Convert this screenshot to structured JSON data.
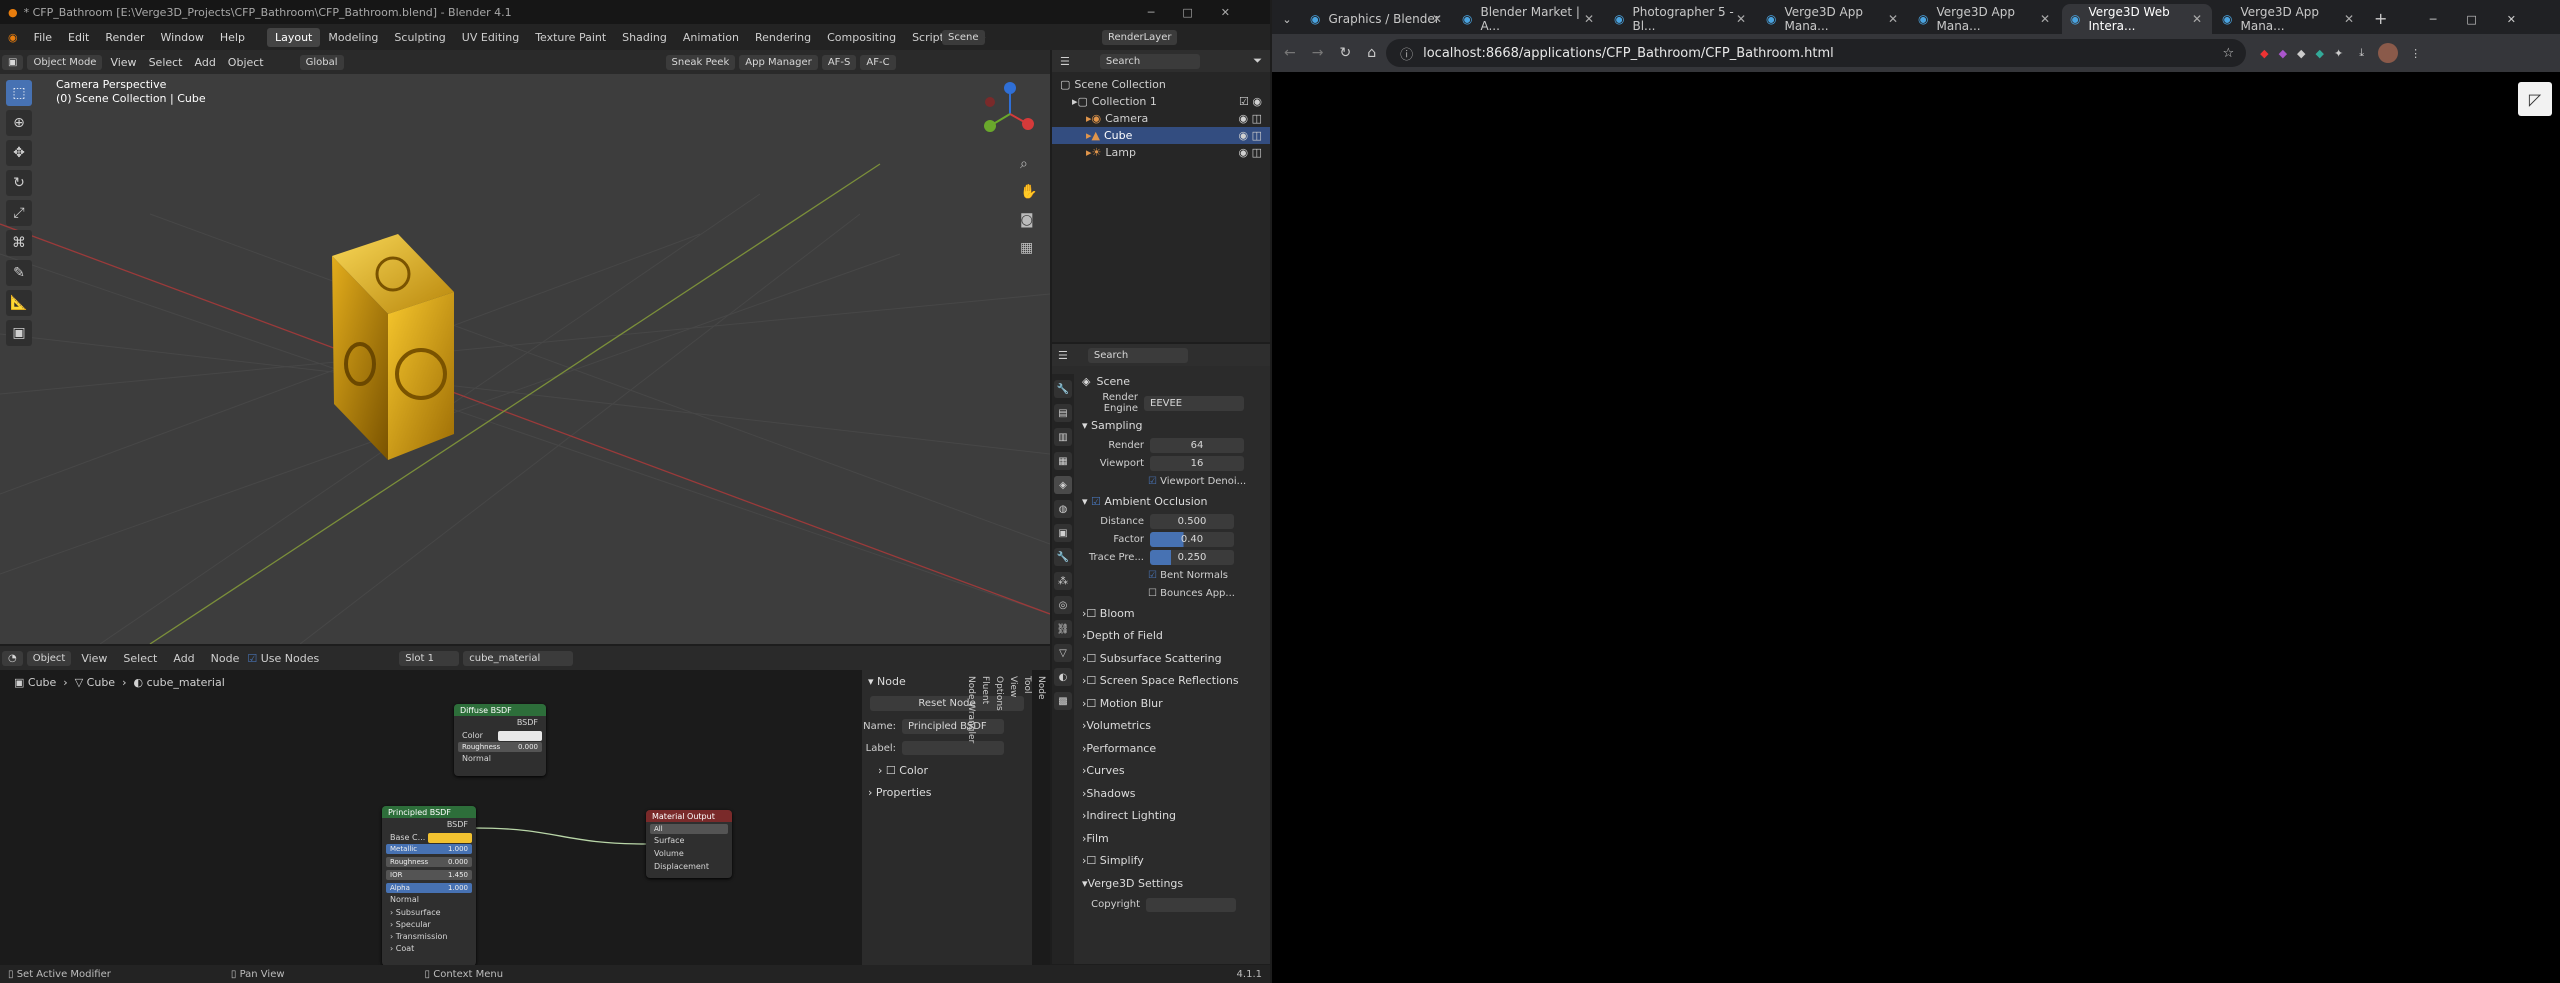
{
  "blender": {
    "title": "* CFP_Bathroom [E:\\Verge3D_Projects\\CFP_Bathroom\\CFP_Bathroom.blend] - Blender 4.1",
    "menu": [
      "File",
      "Edit",
      "Render",
      "Window",
      "Help"
    ],
    "workspaces": [
      "Layout",
      "Modeling",
      "Sculpting",
      "UV Editing",
      "Texture Paint",
      "Shading",
      "Animation",
      "Rendering",
      "Compositing",
      "Scripting"
    ],
    "scene_label": "Scene",
    "view_layer": "RenderLayer",
    "viewport": {
      "mode": "Object Mode",
      "menus": [
        "View",
        "Select",
        "Add",
        "Object"
      ],
      "transform": "Global",
      "sneak_peek": "Sneak Peek",
      "app_manager": "App Manager",
      "afs": "AF-S",
      "afc": "AF-C",
      "overlay_line1": "Camera Perspective",
      "overlay_line2": "(0) Scene Collection | Cube"
    },
    "outliner": {
      "search": "Search",
      "items": [
        {
          "label": "Scene Collection",
          "depth": 0
        },
        {
          "label": "Collection 1",
          "depth": 1
        },
        {
          "label": "Camera",
          "depth": 2
        },
        {
          "label": "Cube",
          "depth": 2
        },
        {
          "label": "Lamp",
          "depth": 2
        }
      ]
    },
    "properties": {
      "search": "Search",
      "context": "Scene",
      "render_engine_label": "Render Engine",
      "render_engine": "EEVEE",
      "sampling": {
        "title": "Sampling",
        "render_label": "Render",
        "render": "64",
        "viewport_label": "Viewport",
        "viewport": "16",
        "denoise": "Viewport Denoi..."
      },
      "ao": {
        "title": "Ambient Occlusion",
        "distance_label": "Distance",
        "distance": "0.500",
        "factor_label": "Factor",
        "factor": "0.40",
        "trace_label": "Trace Pre...",
        "trace": "0.250",
        "bent": "Bent Normals",
        "bounces": "Bounces App..."
      },
      "panels": [
        "Bloom",
        "Depth of Field",
        "Subsurface Scattering",
        "Screen Space Reflections",
        "Motion Blur",
        "Volumetrics",
        "Performance",
        "Curves",
        "Shadows",
        "Indirect Lighting",
        "Film",
        "Simplify",
        "Verge3D Settings"
      ],
      "copyright_label": "Copyright"
    },
    "node_editor": {
      "mode": "Object",
      "menus": [
        "View",
        "Select",
        "Add",
        "Node"
      ],
      "use_nodes": "Use Nodes",
      "slot": "Slot 1",
      "material": "cube_material",
      "breadcrumb": [
        "Cube",
        "Cube",
        "cube_material"
      ],
      "side": {
        "title": "Node",
        "reset": "Reset Node",
        "name_label": "Name:",
        "name": "Principled BSDF",
        "label_label": "Label:",
        "color": "Color",
        "properties": "Properties"
      },
      "side_tabs": [
        "Node",
        "Tool",
        "View",
        "Options",
        "Fluent",
        "Node Wrangler"
      ],
      "diffuse": {
        "title": "Diffuse BSDF",
        "out": "BSDF",
        "color": "Color",
        "roughness": "Roughness",
        "roughness_val": "0.000",
        "normal": "Normal"
      },
      "principled": {
        "title": "Principled BSDF",
        "out": "BSDF",
        "base": "Base C...",
        "metallic": "Metallic",
        "metallic_val": "1.000",
        "roughness": "Roughness",
        "roughness_val": "0.000",
        "ior": "IOR",
        "ior_val": "1.450",
        "alpha": "Alpha",
        "alpha_val": "1.000",
        "normal": "Normal",
        "subs": [
          "Subsurface",
          "Specular",
          "Transmission",
          "Coat"
        ]
      },
      "output": {
        "title": "Material Output",
        "target": "All",
        "surface": "Surface",
        "volume": "Volume",
        "displacement": "Displacement"
      }
    },
    "status": {
      "left": "Set Active Modifier",
      "mid": "Pan View",
      "right": "Context Menu",
      "version": "4.1.1"
    }
  },
  "browser": {
    "tabs": [
      {
        "label": "Graphics / Blender",
        "active": false
      },
      {
        "label": "Blender Market | A...",
        "active": false
      },
      {
        "label": "Photographer 5 - Bl...",
        "active": false
      },
      {
        "label": "Verge3D App Mana...",
        "active": false
      },
      {
        "label": "Verge3D App Mana...",
        "active": false
      },
      {
        "label": "Verge3D Web Intera...",
        "active": true
      },
      {
        "label": "Verge3D App Mana...",
        "active": false
      }
    ],
    "url": "localhost:8668/applications/CFP_Bathroom/CFP_Bathroom.html"
  },
  "colors": {
    "accent": "#4772b3",
    "gold": "#d9a514",
    "base_color": "#f2c230"
  }
}
